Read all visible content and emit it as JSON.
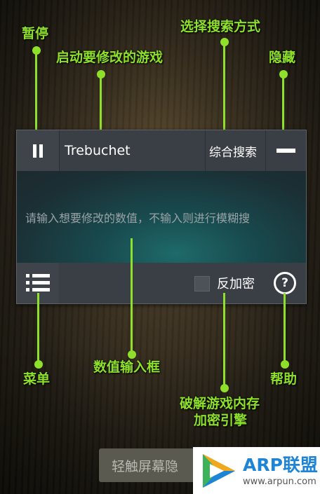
{
  "annotations": {
    "pause": "暂停",
    "launch_game": "启动要修改的游戏",
    "select_search": "选择搜索方式",
    "hide": "隐藏",
    "menu": "菜单",
    "value_input": "数值输入框",
    "help": "帮助",
    "decrypt_line1": "破解游戏内存",
    "decrypt_line2": "加密引擎"
  },
  "toolbar": {
    "game_name": "Trebuchet",
    "search_mode": "综合搜索"
  },
  "input": {
    "placeholder": "请输入想要修改的数值，不输入则进行模糊搜"
  },
  "bottom": {
    "anti_encrypt_label": "反加密",
    "help_symbol": "?"
  },
  "toast": "轻触屏幕隐",
  "watermark": {
    "brand": "ARP联盟",
    "url": "www.arpun.com"
  },
  "colors": {
    "annotation": "#8ee02a",
    "brand": "#1d84d6"
  },
  "icons": [
    "pause-icon",
    "minus-icon",
    "menu-list-icon",
    "help-circle-icon",
    "play-logo-icon"
  ]
}
